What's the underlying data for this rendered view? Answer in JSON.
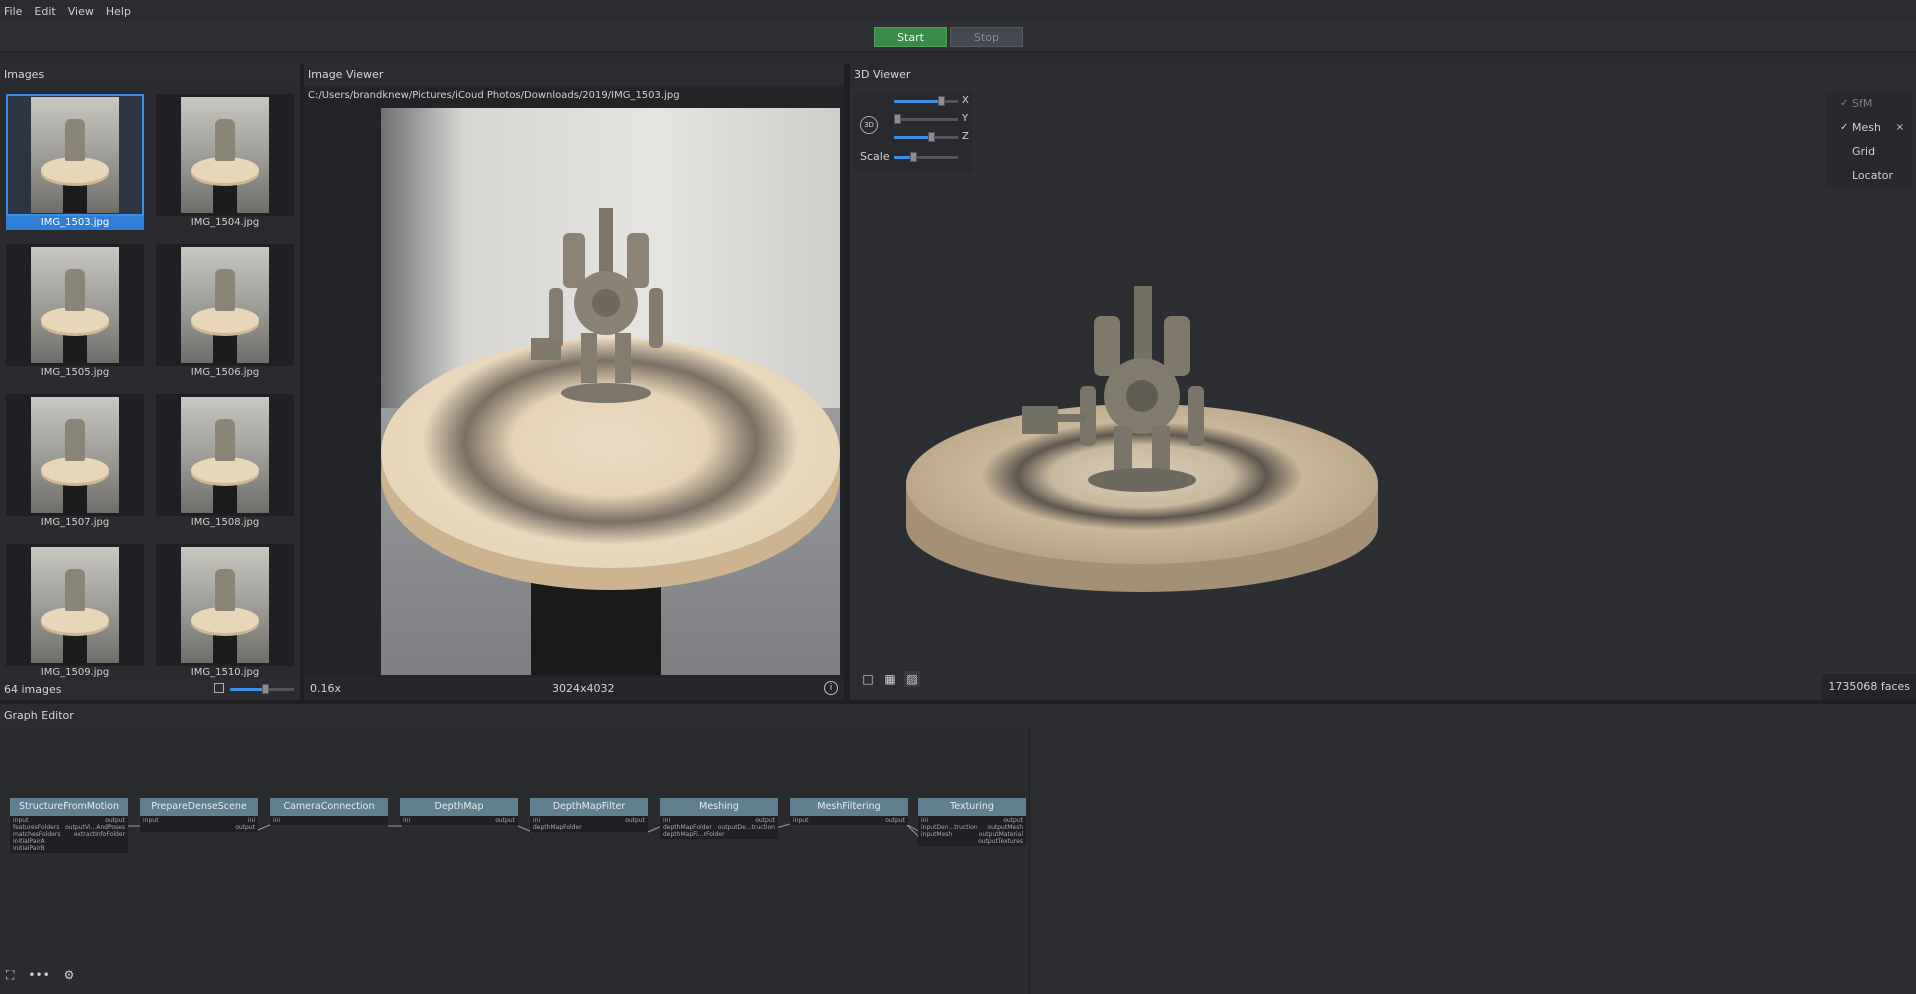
{
  "menu": [
    "File",
    "Edit",
    "View",
    "Help"
  ],
  "toolbar": {
    "start_label": "Start",
    "stop_label": "Stop"
  },
  "images_panel": {
    "title": "Images",
    "count_label": "64 images",
    "thumbnails": [
      {
        "name": "IMG_1503.jpg",
        "selected": true
      },
      {
        "name": "IMG_1504.jpg"
      },
      {
        "name": "IMG_1505.jpg"
      },
      {
        "name": "IMG_1506.jpg"
      },
      {
        "name": "IMG_1507.jpg"
      },
      {
        "name": "IMG_1508.jpg"
      },
      {
        "name": "IMG_1509.jpg"
      },
      {
        "name": "IMG_1510.jpg"
      }
    ]
  },
  "image_viewer": {
    "title": "Image Viewer",
    "path": "C:/Users/brandknew/Pictures/iCoud Photos/Downloads/2019/IMG_1503.jpg",
    "zoom": "0.16x",
    "resolution": "3024x4032"
  },
  "viewer_3d": {
    "title": "3D Viewer",
    "axes": {
      "x": "X",
      "y": "Y",
      "z": "Z",
      "scale_label": "Scale",
      "camera_label": "3D"
    },
    "layers": [
      {
        "label": "SfM",
        "checked": true,
        "enabled": false
      },
      {
        "label": "Mesh",
        "checked": true,
        "enabled": true
      },
      {
        "label": "Grid",
        "checked": false,
        "enabled": true
      },
      {
        "label": "Locator",
        "checked": false,
        "enabled": true
      }
    ],
    "faces": "1735068 faces"
  },
  "graph_editor": {
    "title": "Graph Editor",
    "nodes": [
      {
        "title": "StructureFromMotion",
        "inputs": [
          "input",
          "featuresFolders",
          "matchesFolders",
          "initialPairA",
          "initialPairB"
        ],
        "outputs": [
          "output",
          "outputVi...AndPoses",
          "extractInfoFolder"
        ]
      },
      {
        "title": "PrepareDenseScene",
        "inputs": [
          "input"
        ],
        "outputs": [
          "ini",
          "output"
        ]
      },
      {
        "title": "CameraConnection",
        "inputs": [
          "ini"
        ],
        "outputs": []
      },
      {
        "title": "DepthMap",
        "inputs": [
          "ini"
        ],
        "outputs": [
          "output"
        ]
      },
      {
        "title": "DepthMapFilter",
        "inputs": [
          "ini",
          "depthMapFolder"
        ],
        "outputs": [
          "output"
        ]
      },
      {
        "title": "Meshing",
        "inputs": [
          "ini",
          "depthMapFolder",
          "depthMapFi...rFolder"
        ],
        "outputs": [
          "output",
          "outputDe...truction"
        ]
      },
      {
        "title": "MeshFiltering",
        "inputs": [
          "input"
        ],
        "outputs": [
          "output"
        ]
      },
      {
        "title": "Texturing",
        "inputs": [
          "ini",
          "inputDen...truction",
          "inputMesh"
        ],
        "outputs": [
          "output",
          "outputMesh",
          "outputMaterial",
          "outputTextures"
        ]
      }
    ]
  }
}
